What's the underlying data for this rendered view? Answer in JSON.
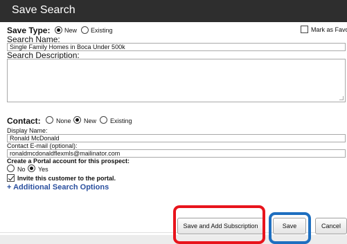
{
  "dialog": {
    "title": "Save Search"
  },
  "save_type": {
    "label": "Save Type:",
    "options": [
      "New",
      "Existing"
    ],
    "selected": "New",
    "favorite_label": "Mark as Favorit"
  },
  "search": {
    "name_label": "Search Name:",
    "name_value": "Single Family Homes in Boca Under 500k",
    "description_label": "Search Description:",
    "description_value": ""
  },
  "contact": {
    "label": "Contact:",
    "options": [
      "None",
      "New",
      "Existing"
    ],
    "selected": "New",
    "display_name_label": "Display Name:",
    "display_name_value": "Ronald McDonald",
    "email_label": "Contact E-mail (optional):",
    "email_value": "ronaldmcdonaldflexmls@mailinator.com"
  },
  "portal": {
    "label": "Create a Portal account for this prospect:",
    "options": [
      "No",
      "Yes"
    ],
    "selected": "Yes",
    "invite_label": "Invite this customer to the portal.",
    "invite_checked": true
  },
  "additional_options_link": "+ Additional Search Options",
  "footer": {
    "save_subscription_label": "Save and Add Subscription",
    "save_label": "Save",
    "cancel_label": "Cancel"
  },
  "colors": {
    "titlebar": "#2e2e2e",
    "link": "#2a4f9e",
    "highlight_red": "#e8141c",
    "highlight_blue": "#1e6fc0"
  }
}
